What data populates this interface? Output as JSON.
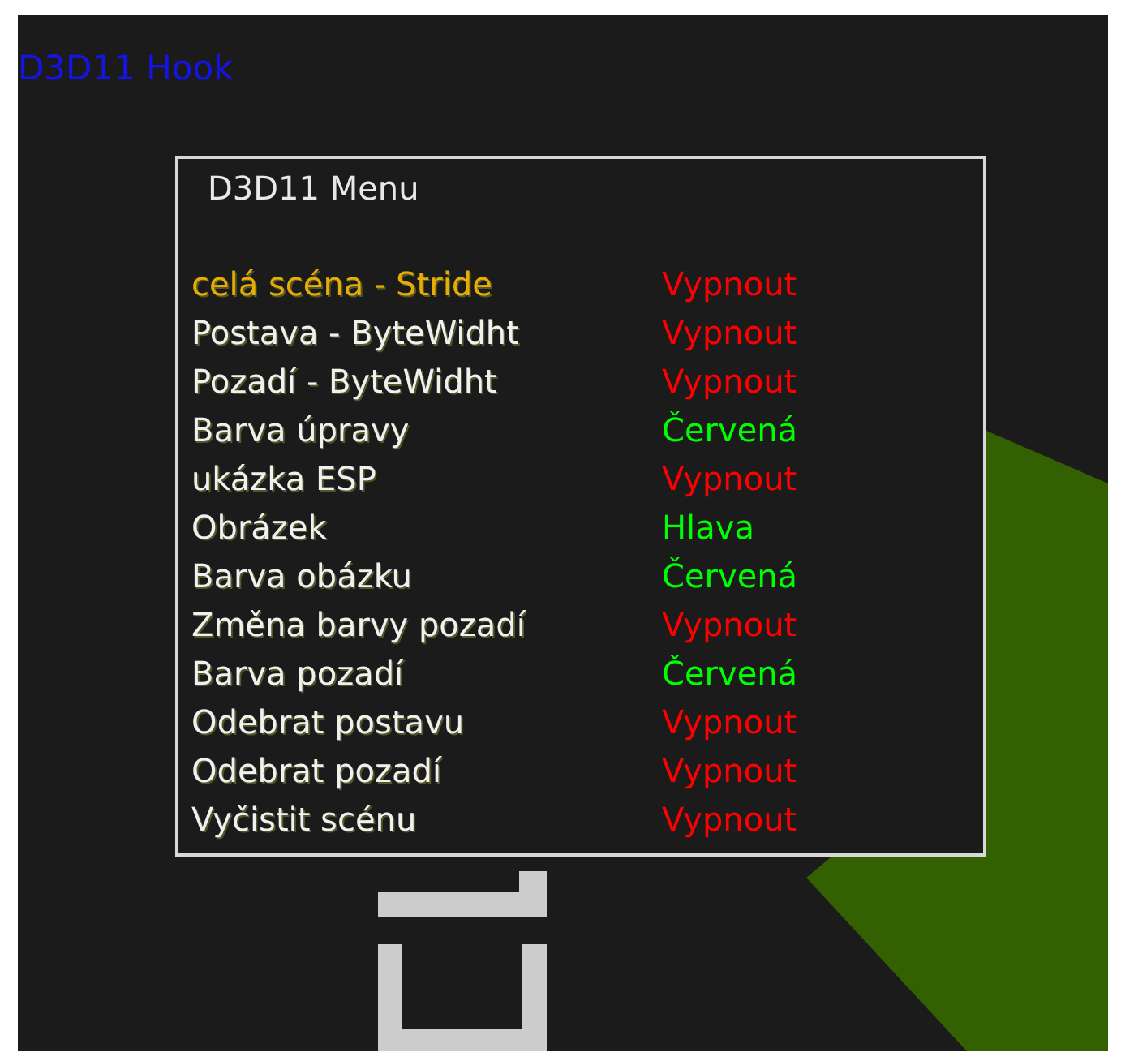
{
  "overlay_title": "D3D11 Hook",
  "menu": {
    "title": "D3D11 Menu",
    "items": [
      {
        "label": "celá scéna - Stride",
        "value": "Vypnout",
        "color": "#ff0000",
        "selected": true
      },
      {
        "label": "Postava - ByteWidht",
        "value": "Vypnout",
        "color": "#ff0000",
        "selected": false
      },
      {
        "label": "Pozadí - ByteWidht",
        "value": "Vypnout",
        "color": "#ff0000",
        "selected": false
      },
      {
        "label": "Barva úpravy",
        "value": "Červená",
        "color": "#00ff00",
        "selected": false
      },
      {
        "label": "ukázka ESP",
        "value": "Vypnout",
        "color": "#ff0000",
        "selected": false
      },
      {
        "label": "Obrázek",
        "value": "Hlava",
        "color": "#00ff00",
        "selected": false
      },
      {
        "label": "Barva obázku",
        "value": "Červená",
        "color": "#00ff00",
        "selected": false
      },
      {
        "label": "Změna barvy pozadí",
        "value": "Vypnout",
        "color": "#ff0000",
        "selected": false
      },
      {
        "label": "Barva pozadí",
        "value": "Červená",
        "color": "#00ff00",
        "selected": false
      },
      {
        "label": "Odebrat postavu",
        "value": "Vypnout",
        "color": "#ff0000",
        "selected": false
      },
      {
        "label": "Odebrat pozadí",
        "value": "Vypnout",
        "color": "#ff0000",
        "selected": false
      },
      {
        "label": "Vyčistit scénu",
        "value": "Vypnout",
        "color": "#ff0000",
        "selected": false
      }
    ]
  }
}
